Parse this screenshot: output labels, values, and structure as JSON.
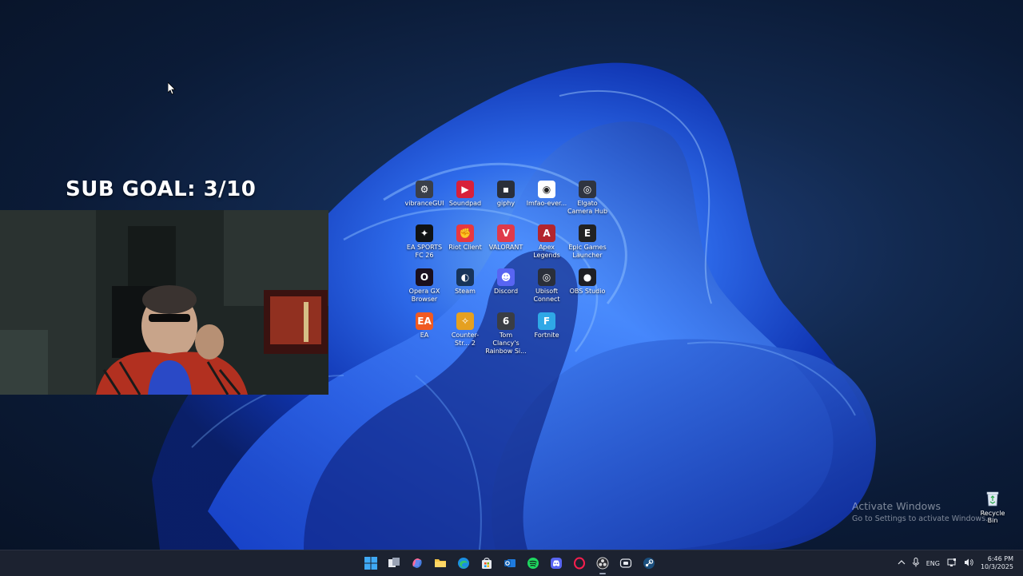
{
  "overlay": {
    "sub_goal": "SUB GOAL: 3/10"
  },
  "desktop_icons": [
    {
      "label": "vibranceGUI",
      "icon": "gear-icon",
      "color": "#3a3f4a",
      "glyph": "⚙"
    },
    {
      "label": "Soundpad",
      "icon": "soundpad-icon",
      "color": "#d8203a",
      "glyph": "▶"
    },
    {
      "label": "giphy",
      "icon": "image-file-icon",
      "color": "#2a2f3a",
      "glyph": "▪"
    },
    {
      "label": "lmfao-ever...",
      "icon": "document-icon",
      "color": "#ffffff",
      "glyph": "◉"
    },
    {
      "label": "Elgato Camera Hub",
      "icon": "camera-hub-icon",
      "color": "#2f3440",
      "glyph": "◎"
    },
    {
      "label": "EA SPORTS FC 26",
      "icon": "ea-fc-icon",
      "color": "#101214",
      "glyph": "✦"
    },
    {
      "label": "Riot Client",
      "icon": "riot-client-icon",
      "color": "#e8383f",
      "glyph": "✊"
    },
    {
      "label": "VALORANT",
      "icon": "valorant-icon",
      "color": "#e03a4a",
      "glyph": "V"
    },
    {
      "label": "Apex Legends",
      "icon": "apex-legends-icon",
      "color": "#b3252d",
      "glyph": "A"
    },
    {
      "label": "Epic Games Launcher",
      "icon": "epic-games-icon",
      "color": "#222222",
      "glyph": "E"
    },
    {
      "label": "Opera GX Browser",
      "icon": "opera-gx-icon",
      "color": "#1a0f1e",
      "glyph": "O"
    },
    {
      "label": "Steam",
      "icon": "steam-icon",
      "color": "#17345a",
      "glyph": "◐"
    },
    {
      "label": "Discord",
      "icon": "discord-icon",
      "color": "#5865f2",
      "glyph": "☻"
    },
    {
      "label": "Ubisoft Connect",
      "icon": "ubisoft-icon",
      "color": "#2a2f3a",
      "glyph": "◎"
    },
    {
      "label": "OBS Studio",
      "icon": "obs-icon",
      "color": "#1f1f24",
      "glyph": "●"
    },
    {
      "label": "EA",
      "icon": "ea-icon",
      "color": "#f05a22",
      "glyph": "EA"
    },
    {
      "label": "Counter-Str... 2",
      "icon": "counter-strike-icon",
      "color": "#e5a020",
      "glyph": "✧"
    },
    {
      "label": "Tom Clancy's Rainbow Si...",
      "icon": "rainbow-six-icon",
      "color": "#3a3d44",
      "glyph": "6"
    },
    {
      "label": "Fortnite",
      "icon": "fortnite-icon",
      "color": "#2fa8e6",
      "glyph": "F"
    }
  ],
  "activation": {
    "title": "Activate Windows",
    "subtitle": "Go to Settings to activate Windows."
  },
  "recycle_bin": {
    "label": "Recycle Bin"
  },
  "taskbar": {
    "apps": [
      {
        "name": "start-button",
        "icon": "windows-start-icon"
      },
      {
        "name": "task-view-button",
        "icon": "task-view-icon"
      },
      {
        "name": "copilot-button",
        "icon": "copilot-icon"
      },
      {
        "name": "file-explorer-button",
        "icon": "folder-icon"
      },
      {
        "name": "edge-button",
        "icon": "edge-icon"
      },
      {
        "name": "store-button",
        "icon": "store-icon"
      },
      {
        "name": "outlook-button",
        "icon": "outlook-icon"
      },
      {
        "name": "spotify-button",
        "icon": "spotify-icon"
      },
      {
        "name": "discord-button",
        "icon": "discord-icon"
      },
      {
        "name": "opera-gx-button",
        "icon": "opera-gx-icon"
      },
      {
        "name": "obs-button",
        "icon": "obs-icon",
        "active": true
      },
      {
        "name": "media-button",
        "icon": "media-icon"
      },
      {
        "name": "steam-button",
        "icon": "steam-icon"
      }
    ],
    "tray": {
      "language": "ENG",
      "time": "6:46 PM",
      "date": "10/3/2025"
    }
  }
}
